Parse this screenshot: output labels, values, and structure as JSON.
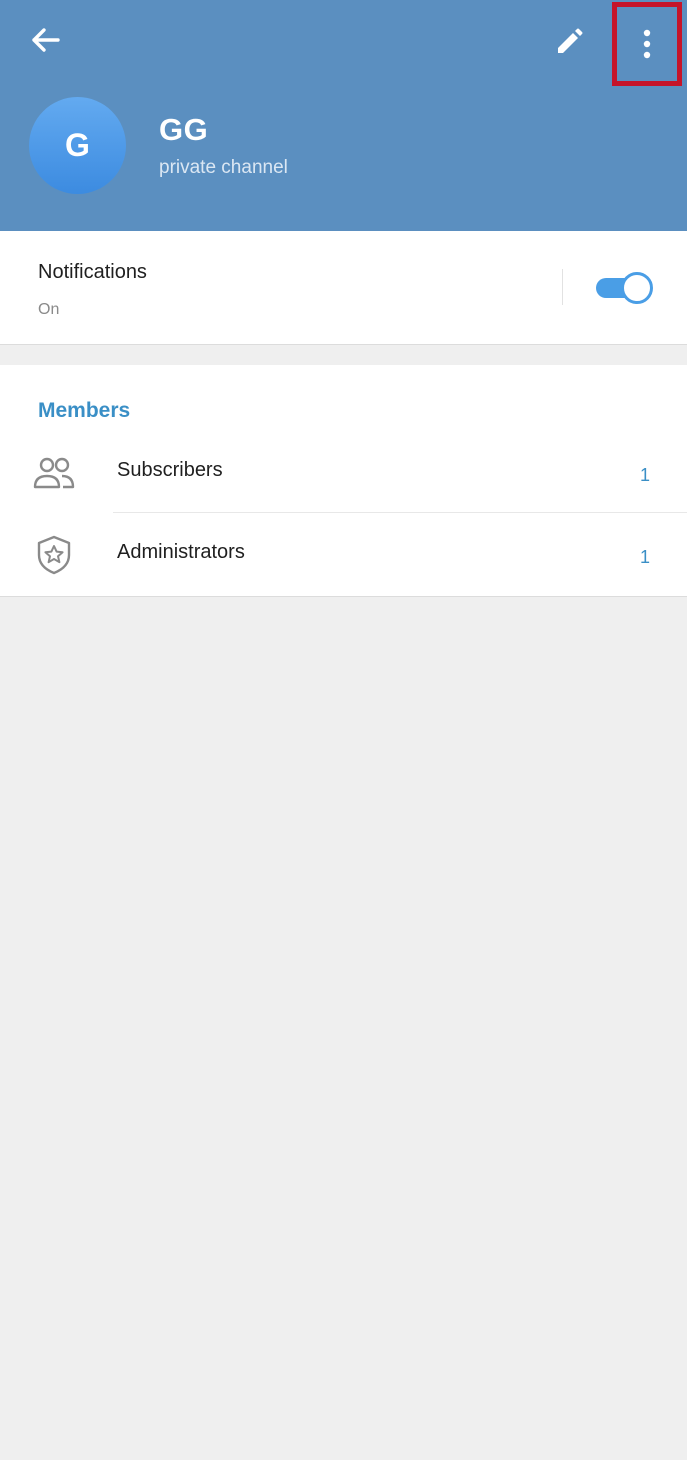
{
  "header": {
    "channel_name": "GG",
    "channel_type": "private channel",
    "avatar_letter": "G",
    "icons": {
      "back": "arrow-left-icon",
      "edit": "pencil-icon",
      "more": "more-vertical-icon"
    },
    "colors": {
      "background": "#5b8fc0",
      "avatar": "#4a9ae8",
      "highlight_box": "#c5142a"
    }
  },
  "notifications": {
    "title": "Notifications",
    "status": "On",
    "enabled": true
  },
  "members": {
    "header": "Members",
    "items": [
      {
        "label": "Subscribers",
        "count": "1",
        "icon": "users-icon"
      },
      {
        "label": "Administrators",
        "count": "1",
        "icon": "shield-star-icon"
      }
    ]
  },
  "colors": {
    "accent": "#3a8fc6",
    "toggle": "#4a9ee6",
    "page_background": "#efefef"
  }
}
